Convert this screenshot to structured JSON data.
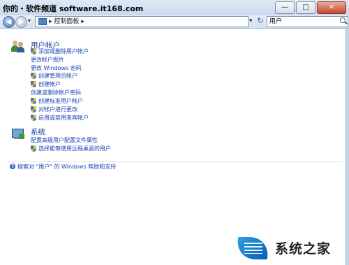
{
  "watermark": "你的・软件频道 software.it168.com",
  "window": {
    "minimize": "—",
    "maximize": "□",
    "close": "✕"
  },
  "nav": {
    "back": "◀",
    "forward": "▶",
    "history_arrow": "▾",
    "address_text": "▸ 控制面板 ▸",
    "address_arrow": "▾",
    "refresh": "↻",
    "search_value": "用户"
  },
  "categories": [
    {
      "title": "用户帐户",
      "links": [
        {
          "label": "添加或删除用户帐户",
          "shield": true
        },
        {
          "label": "更改帐户图片",
          "shield": false
        },
        {
          "label": "更改 Windows 密码",
          "shield": false
        },
        {
          "label": "创建管理员帐户",
          "shield": true
        },
        {
          "label": "创建帐户",
          "shield": true
        },
        {
          "label": "创建或删除帐户密码",
          "shield": false
        },
        {
          "label": "创建标准用户帐户",
          "shield": true
        },
        {
          "label": "对帐户进行更改",
          "shield": true
        },
        {
          "label": "启用或禁用来宾帐户",
          "shield": true
        }
      ]
    },
    {
      "title": "系统",
      "links": [
        {
          "label": "配置高级用户配置文件属性",
          "shield": false
        },
        {
          "label": "选择能够使用远程桌面的用户",
          "shield": true
        }
      ]
    }
  ],
  "help": {
    "icon": "?",
    "label": "搜索对 \"用户\" 的 Windows 帮助和支持"
  },
  "logo": {
    "text": "系统之家"
  }
}
